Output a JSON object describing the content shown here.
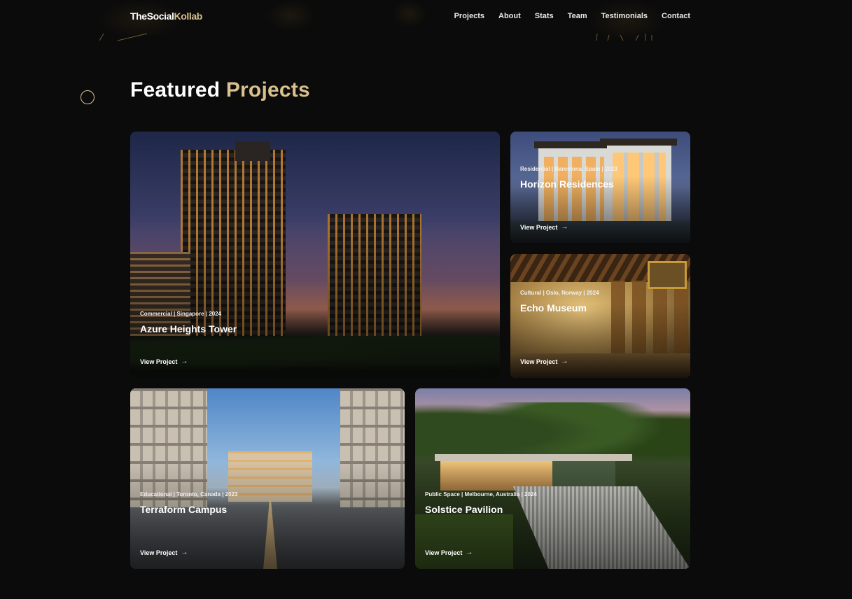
{
  "nav": {
    "logo_part1": "TheSocial",
    "logo_part2": "Kollab",
    "links": [
      "Projects",
      "About",
      "Stats",
      "Team",
      "Testimonials",
      "Contact"
    ]
  },
  "section": {
    "title_part1": "Featured",
    "title_part2": "Projects"
  },
  "projects": [
    {
      "meta": "Commercial | Singapore | 2024",
      "title": "Azure Heights Tower",
      "link": "View Project"
    },
    {
      "meta": "Residential | Barcelona, Spain | 2023",
      "title": "Horizon Residences",
      "link": "View Project"
    },
    {
      "meta": "Cultural | Oslo, Norway | 2024",
      "title": "Echo Museum",
      "link": "View Project"
    },
    {
      "meta": "Educational | Toronto, Canada | 2023",
      "title": "Terraform Campus",
      "link": "View Project"
    },
    {
      "meta": "Public Space | Melbourne, Australia | 2024",
      "title": "Solstice Pavilion",
      "link": "View Project"
    }
  ],
  "colors": {
    "background": "#0b0b0b",
    "accent": "#d9c08c",
    "text": "#ffffff"
  },
  "icons": {
    "card_link": "arrow-right-icon",
    "decoration": "circle-outline-icon"
  }
}
